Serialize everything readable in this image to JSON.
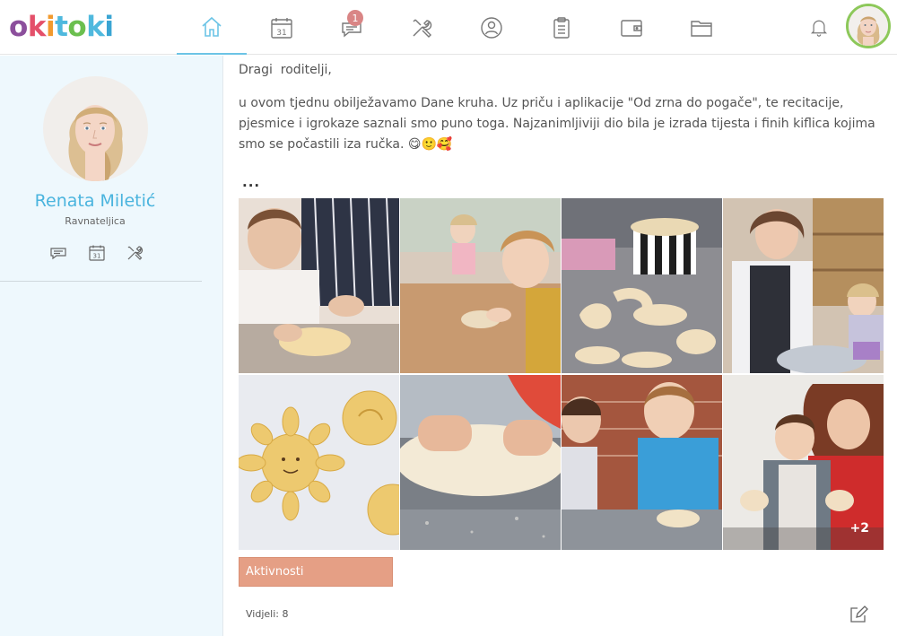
{
  "brand": {
    "name": "okitoki"
  },
  "colors": {
    "accent": "#4ab4de",
    "badge": "#d98585",
    "tag_button": "#e59f85",
    "sidebar_bg": "#eef8fd",
    "avatar_ring": "#8dc85a"
  },
  "nav": {
    "items": [
      {
        "icon": "home-icon",
        "active": true
      },
      {
        "icon": "calendar-icon",
        "label": "31"
      },
      {
        "icon": "messages-icon",
        "badge": "1"
      },
      {
        "icon": "tools-icon"
      },
      {
        "icon": "profile-icon"
      },
      {
        "icon": "clipboard-icon"
      },
      {
        "icon": "wallet-icon"
      },
      {
        "icon": "folder-icon"
      }
    ],
    "notifications_icon": "bell-icon"
  },
  "sidebar": {
    "name": "Renata Miletić",
    "role": "Ravnateljica",
    "calendar_day": "31",
    "actions": [
      "messages-icon",
      "calendar-icon",
      "tools-icon"
    ]
  },
  "post": {
    "greeting": "Dragi  roditelji,",
    "body": "u ovom tjednu obilježavamo  Dane kruha. Uz priču i aplikacije \"Od zrna do pogače\", te recitacije, pjesmice i igrokaze saznali smo puno toga. Najzanimljiviji dio bila je izrada tijesta i finih kiflica kojima smo se počastili iza ručka. 😋🙂🥰",
    "more": "...",
    "photos": [
      "kid-kneading-dough",
      "girl-rolling-dough",
      "dough-shapes-on-tray",
      "teacher-with-girl",
      "sun-shaped-bun",
      "hands-on-dough",
      "kids-at-table",
      "mother-and-son-baking"
    ],
    "extra_photos": "+2",
    "tag": "Aktivnosti",
    "seen": "Vidjeli: 8"
  }
}
